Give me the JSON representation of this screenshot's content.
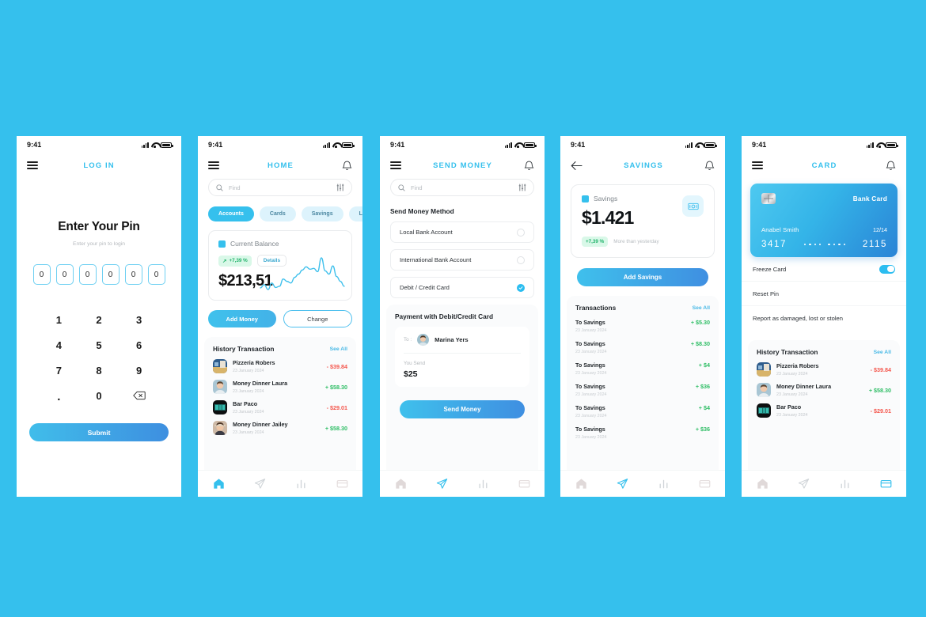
{
  "theme": {
    "background": "#35c0ed",
    "accent": "#35c0ed",
    "positive": "#2dbd64",
    "negative": "#f4564c",
    "badge_bg": "#d9f8e8",
    "badge_text": "#22b36b"
  },
  "statusbar": {
    "time": "9:41"
  },
  "screens": {
    "login": {
      "title": "LOG IN",
      "heading": "Enter Your Pin",
      "subheading": "Enter your pin to login",
      "pin_digits": [
        "0",
        "0",
        "0",
        "0",
        "0",
        "0"
      ],
      "keypad": [
        "1",
        "2",
        "3",
        "4",
        "5",
        "6",
        "7",
        "8",
        "9",
        ".",
        "0",
        "backspace"
      ],
      "submit_label": "Submit"
    },
    "home": {
      "title": "HOME",
      "search_placeholder": "Find",
      "search_value": "",
      "tabs": [
        {
          "label": "Accounts",
          "active": true
        },
        {
          "label": "Cards",
          "active": false
        },
        {
          "label": "Savings",
          "active": false
        },
        {
          "label": "L",
          "active": false
        }
      ],
      "balance_card": {
        "label": "Current Balance",
        "change_pct": "+7,39 %",
        "change_arrow": "↗",
        "details_label": "Details",
        "amount": "$213,51"
      },
      "actions": {
        "primary": "Add Money",
        "secondary": "Change"
      },
      "history": {
        "title": "History Transaction",
        "see_all": "See All",
        "items": [
          {
            "name": "Pizzeria Robers",
            "date": "23 January 2024",
            "amount": "- $39.84",
            "sign": "neg"
          },
          {
            "name": "Money Dinner Laura",
            "date": "23 January 2024",
            "amount": "+ $58.30",
            "sign": "pos"
          },
          {
            "name": "Bar Paco",
            "date": "23 January 2024",
            "amount": "- $29.01",
            "sign": "neg"
          },
          {
            "name": "Money Dinner Jailey",
            "date": "23 January 2024",
            "amount": "+ $58.30",
            "sign": "pos"
          }
        ]
      }
    },
    "send_money": {
      "title": "SEND MONEY",
      "search_placeholder": "Find",
      "search_value": "",
      "method_title": "Send Money Method",
      "methods": [
        {
          "label": "Local Bank Account",
          "selected": false
        },
        {
          "label": "International Bank Account",
          "selected": false
        },
        {
          "label": "Debit / Credit Card",
          "selected": true
        }
      ],
      "payment_title": "Payment with Debit/Credit Card",
      "to_label": "To :",
      "to_name": "Marina Yers",
      "you_send_label": "You Send",
      "you_send_amount": "$25",
      "send_label": "Send Money"
    },
    "savings": {
      "title": "SAVINGS",
      "card": {
        "label": "Savings",
        "amount": "$1.421",
        "change_pct": "+7,39 %",
        "note": "More than yesterday"
      },
      "add_label": "Add Savings",
      "transactions": {
        "title": "Transactions",
        "see_all": "See All",
        "items": [
          {
            "name": "To Savings",
            "date": "23 January 2024",
            "amount": "+ $5.30"
          },
          {
            "name": "To Savings",
            "date": "23 January 2024",
            "amount": "+ $8.30"
          },
          {
            "name": "To Savings",
            "date": "23 January 2024",
            "amount": "+ $4"
          },
          {
            "name": "To Savings",
            "date": "23 January 2024",
            "amount": "+ $36"
          },
          {
            "name": "To Savings",
            "date": "23 January 2024",
            "amount": "+ $4"
          },
          {
            "name": "To Savings",
            "date": "23 January 2024",
            "amount": "+ $36"
          }
        ]
      }
    },
    "card": {
      "title": "CARD",
      "bank_card": {
        "brand": "Bank Card",
        "holder": "Anabel Smith",
        "expiry": "12/14",
        "number_start": "3417",
        "number_end": "2115"
      },
      "settings": [
        {
          "label": "Freeze Card",
          "control": "toggle",
          "on": true
        },
        {
          "label": "Reset Pin",
          "control": "none"
        },
        {
          "label": "Report as damaged, lost or stolen",
          "control": "none"
        }
      ],
      "history": {
        "title": "History Transaction",
        "see_all": "See All",
        "items": [
          {
            "name": "Pizzeria Robers",
            "date": "23 January 2024",
            "amount": "- $39.84",
            "sign": "neg"
          },
          {
            "name": "Money Dinner Laura",
            "date": "23 January 2024",
            "amount": "+ $58.30",
            "sign": "pos"
          },
          {
            "name": "Bar Paco",
            "date": "23 January 2024",
            "amount": "- $29.01",
            "sign": "neg"
          }
        ]
      }
    }
  },
  "bottom_nav": [
    {
      "icon": "home-icon",
      "active_on": [
        "home"
      ]
    },
    {
      "icon": "send-icon",
      "active_on": [
        "send_money",
        "savings"
      ]
    },
    {
      "icon": "chart-icon",
      "active_on": []
    },
    {
      "icon": "card-icon",
      "active_on": [
        "card"
      ]
    }
  ],
  "chart_data": {
    "type": "line",
    "title": "Current Balance sparkline",
    "xlabel": "",
    "ylabel": "",
    "x": [
      0,
      1,
      2,
      3,
      4,
      5,
      6,
      7,
      8,
      9,
      10,
      11,
      12,
      13,
      14,
      15,
      16,
      17,
      18,
      19,
      20,
      21,
      22
    ],
    "values": [
      18,
      26,
      14,
      30,
      19,
      22,
      40,
      34,
      30,
      44,
      52,
      62,
      70,
      64,
      66,
      58,
      92,
      60,
      52,
      72,
      46,
      34,
      22
    ],
    "ylim": [
      0,
      100
    ],
    "grid": false,
    "legend": "none",
    "color": "#3fc0ec"
  }
}
